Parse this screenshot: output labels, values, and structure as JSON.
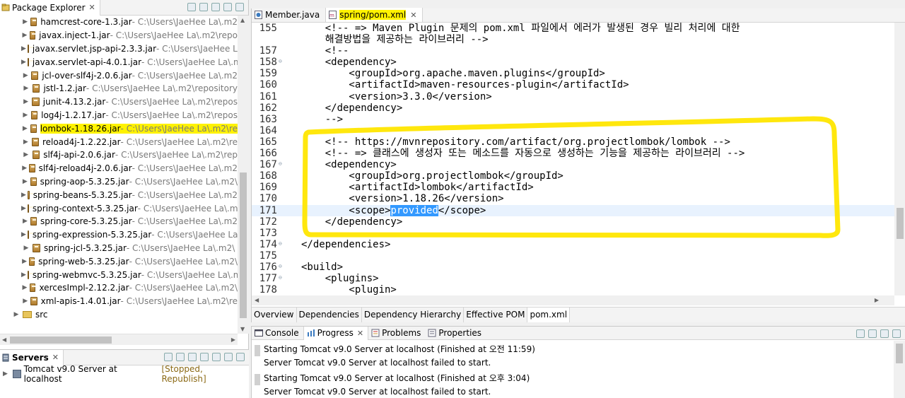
{
  "package_explorer": {
    "title": "Package Explorer",
    "items": [
      {
        "name": "hamcrest-core-1.3.jar",
        "path": " - C:\\Users\\JaeHee La\\.m2"
      },
      {
        "name": "javax.inject-1.jar",
        "path": " - C:\\Users\\JaeHee La\\.m2\\repo"
      },
      {
        "name": "javax.servlet.jsp-api-2.3.3.jar",
        "path": " - C:\\Users\\JaeHee La"
      },
      {
        "name": "javax.servlet-api-4.0.1.jar",
        "path": " - C:\\Users\\JaeHee La\\.m2"
      },
      {
        "name": "jcl-over-slf4j-2.0.6.jar",
        "path": " - C:\\Users\\JaeHee La\\.m2"
      },
      {
        "name": "jstl-1.2.jar",
        "path": " - C:\\Users\\JaeHee La\\.m2\\repository"
      },
      {
        "name": "junit-4.13.2.jar",
        "path": " - C:\\Users\\JaeHee La\\.m2\\repos"
      },
      {
        "name": "log4j-1.2.17.jar",
        "path": " - C:\\Users\\JaeHee La\\.m2\\repos"
      },
      {
        "name": "lombok-1.18.26.jar",
        "path": " - C:\\Users\\JaeHee La\\.m2\\re"
      },
      {
        "name": "reload4j-1.2.22.jar",
        "path": " - C:\\Users\\JaeHee La\\.m2\\re"
      },
      {
        "name": "slf4j-api-2.0.6.jar",
        "path": " - C:\\Users\\JaeHee La\\.m2\\rep"
      },
      {
        "name": "slf4j-reload4j-2.0.6.jar",
        "path": " - C:\\Users\\JaeHee La\\.m2"
      },
      {
        "name": "spring-aop-5.3.25.jar",
        "path": " - C:\\Users\\JaeHee La\\.m2\\"
      },
      {
        "name": "spring-beans-5.3.25.jar",
        "path": " - C:\\Users\\JaeHee La\\.m2"
      },
      {
        "name": "spring-context-5.3.25.jar",
        "path": " - C:\\Users\\JaeHee La\\.m"
      },
      {
        "name": "spring-core-5.3.25.jar",
        "path": " - C:\\Users\\JaeHee La\\.m2"
      },
      {
        "name": "spring-expression-5.3.25.jar",
        "path": " - C:\\Users\\JaeHee La"
      },
      {
        "name": "spring-jcl-5.3.25.jar",
        "path": " - C:\\Users\\JaeHee La\\.m2\\"
      },
      {
        "name": "spring-web-5.3.25.jar",
        "path": " - C:\\Users\\JaeHee La\\.m2\\"
      },
      {
        "name": "spring-webmvc-5.3.25.jar",
        "path": " - C:\\Users\\JaeHee La\\.m2"
      },
      {
        "name": "xercesImpl-2.12.2.jar",
        "path": " - C:\\Users\\JaeHee La\\.m2\\"
      },
      {
        "name": "xml-apis-1.4.01.jar",
        "path": " - C:\\Users\\JaeHee La\\.m2\\re"
      }
    ],
    "src_label": "src",
    "highlight_color": "#fff200"
  },
  "servers": {
    "title": "Servers",
    "row_name": "Tomcat v9.0 Server at localhost",
    "row_state": "[Stopped, Republish]"
  },
  "editor": {
    "tabs": [
      "Member.java",
      "spring/pom.xml"
    ],
    "lines": [
      {
        "n": "155",
        "t": "    <!-- => Maven Plugin 문제의 pom.xml 파일에서 에러가 발생된 경우 빌리 처리에 대한"
      },
      {
        "n": "",
        "t": "    해결방법을 제공하는 라이브러리 -->"
      },
      {
        "n": "157",
        "t": "    <!--"
      },
      {
        "n": "158",
        "t": "    <dependency>"
      },
      {
        "n": "159",
        "t": "        <groupId>org.apache.maven.plugins</groupId>"
      },
      {
        "n": "160",
        "t": "        <artifactId>maven-resources-plugin</artifactId>"
      },
      {
        "n": "161",
        "t": "        <version>3.3.0</version>"
      },
      {
        "n": "162",
        "t": "    </dependency>"
      },
      {
        "n": "163",
        "t": "    -->"
      },
      {
        "n": "164",
        "t": ""
      },
      {
        "n": "165",
        "t": "    <!-- https://mvnrepository.com/artifact/org.projectlombok/lombok -->"
      },
      {
        "n": "166",
        "t": "    <!-- => 클래스에 생성자 또는 메소드를 자동으로 생성하는 기능을 제공하는 라이브러리 -->"
      },
      {
        "n": "167",
        "t": "    <dependency>"
      },
      {
        "n": "168",
        "t": "        <groupId>org.projectlombok</groupId>"
      },
      {
        "n": "169",
        "t": "        <artifactId>lombok</artifactId>"
      },
      {
        "n": "170",
        "t": "        <version>1.18.26</version>"
      },
      {
        "n": "171",
        "t_pre": "        <scope>",
        "t_sel": "provided",
        "t_post": "</scope>"
      },
      {
        "n": "172",
        "t": "    </dependency>"
      },
      {
        "n": "173",
        "t": ""
      },
      {
        "n": "174",
        "t": "</dependencies>"
      },
      {
        "n": "175",
        "t": ""
      },
      {
        "n": "176",
        "t": "<build>"
      },
      {
        "n": "177",
        "t": "    <plugins>"
      },
      {
        "n": "178",
        "t": "        <plugin>"
      }
    ],
    "pom_tabs": [
      "Overview",
      "Dependencies",
      "Dependency Hierarchy",
      "Effective POM",
      "pom.xml"
    ]
  },
  "console": {
    "tabs": [
      "Console",
      "Progress",
      "Problems",
      "Properties"
    ],
    "entries": [
      {
        "title": "Starting Tomcat v9.0 Server at localhost (Finished at 오전 11:59)",
        "detail": "Server Tomcat v9.0 Server at localhost failed to start."
      },
      {
        "title": "Starting Tomcat v9.0 Server at localhost (Finished at 오후 3:04)",
        "detail": "Server Tomcat v9.0 Server at localhost failed to start."
      }
    ]
  },
  "colors": {
    "annotation": "#ffe600",
    "selection": "#3399ff",
    "current_line": "#e8f2fe"
  }
}
